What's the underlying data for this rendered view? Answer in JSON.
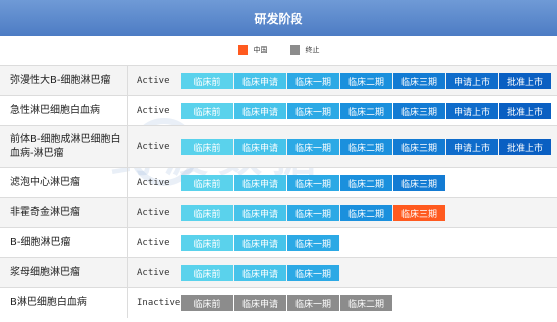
{
  "title": "研发阶段",
  "legend": [
    {
      "label": "中国",
      "color": "#ff5a1f"
    },
    {
      "label": "终止",
      "color": "#8c8c8c"
    }
  ],
  "watermark": "药渡数据",
  "chart_data": {
    "type": "table",
    "stage_names": [
      "临床前",
      "临床申请",
      "临床一期",
      "临床二期",
      "临床三期",
      "申请上市",
      "批准上市"
    ],
    "stage_colors": [
      "#5ad2ec",
      "#46c3ea",
      "#2ca9e5",
      "#1b90dd",
      "#137bd3",
      "#0f6ccb",
      "#0a5fc2"
    ],
    "china_color": "#ff5a1f",
    "terminated_color": "#8c8c8c",
    "rows": [
      {
        "indication": "弥漫性大B-细胞淋巴瘤",
        "status": "Active",
        "stages": 7,
        "highlight": null,
        "terminated": false
      },
      {
        "indication": "急性淋巴细胞白血病",
        "status": "Active",
        "stages": 7,
        "highlight": null,
        "terminated": false
      },
      {
        "indication": "前体B-细胞成淋巴细胞白血病-淋巴瘤",
        "status": "Active",
        "stages": 7,
        "highlight": null,
        "terminated": false
      },
      {
        "indication": "滤泡中心淋巴瘤",
        "status": "Active",
        "stages": 5,
        "highlight": null,
        "terminated": false
      },
      {
        "indication": "非霍奇金淋巴瘤",
        "status": "Active",
        "stages": 5,
        "highlight": 5,
        "terminated": false
      },
      {
        "indication": "B-细胞淋巴瘤",
        "status": "Active",
        "stages": 3,
        "highlight": null,
        "terminated": false
      },
      {
        "indication": "浆母细胞淋巴瘤",
        "status": "Active",
        "stages": 3,
        "highlight": null,
        "terminated": false
      },
      {
        "indication": "B淋巴细胞白血病",
        "status": "Inactive",
        "stages": 4,
        "highlight": null,
        "terminated": true
      }
    ]
  }
}
